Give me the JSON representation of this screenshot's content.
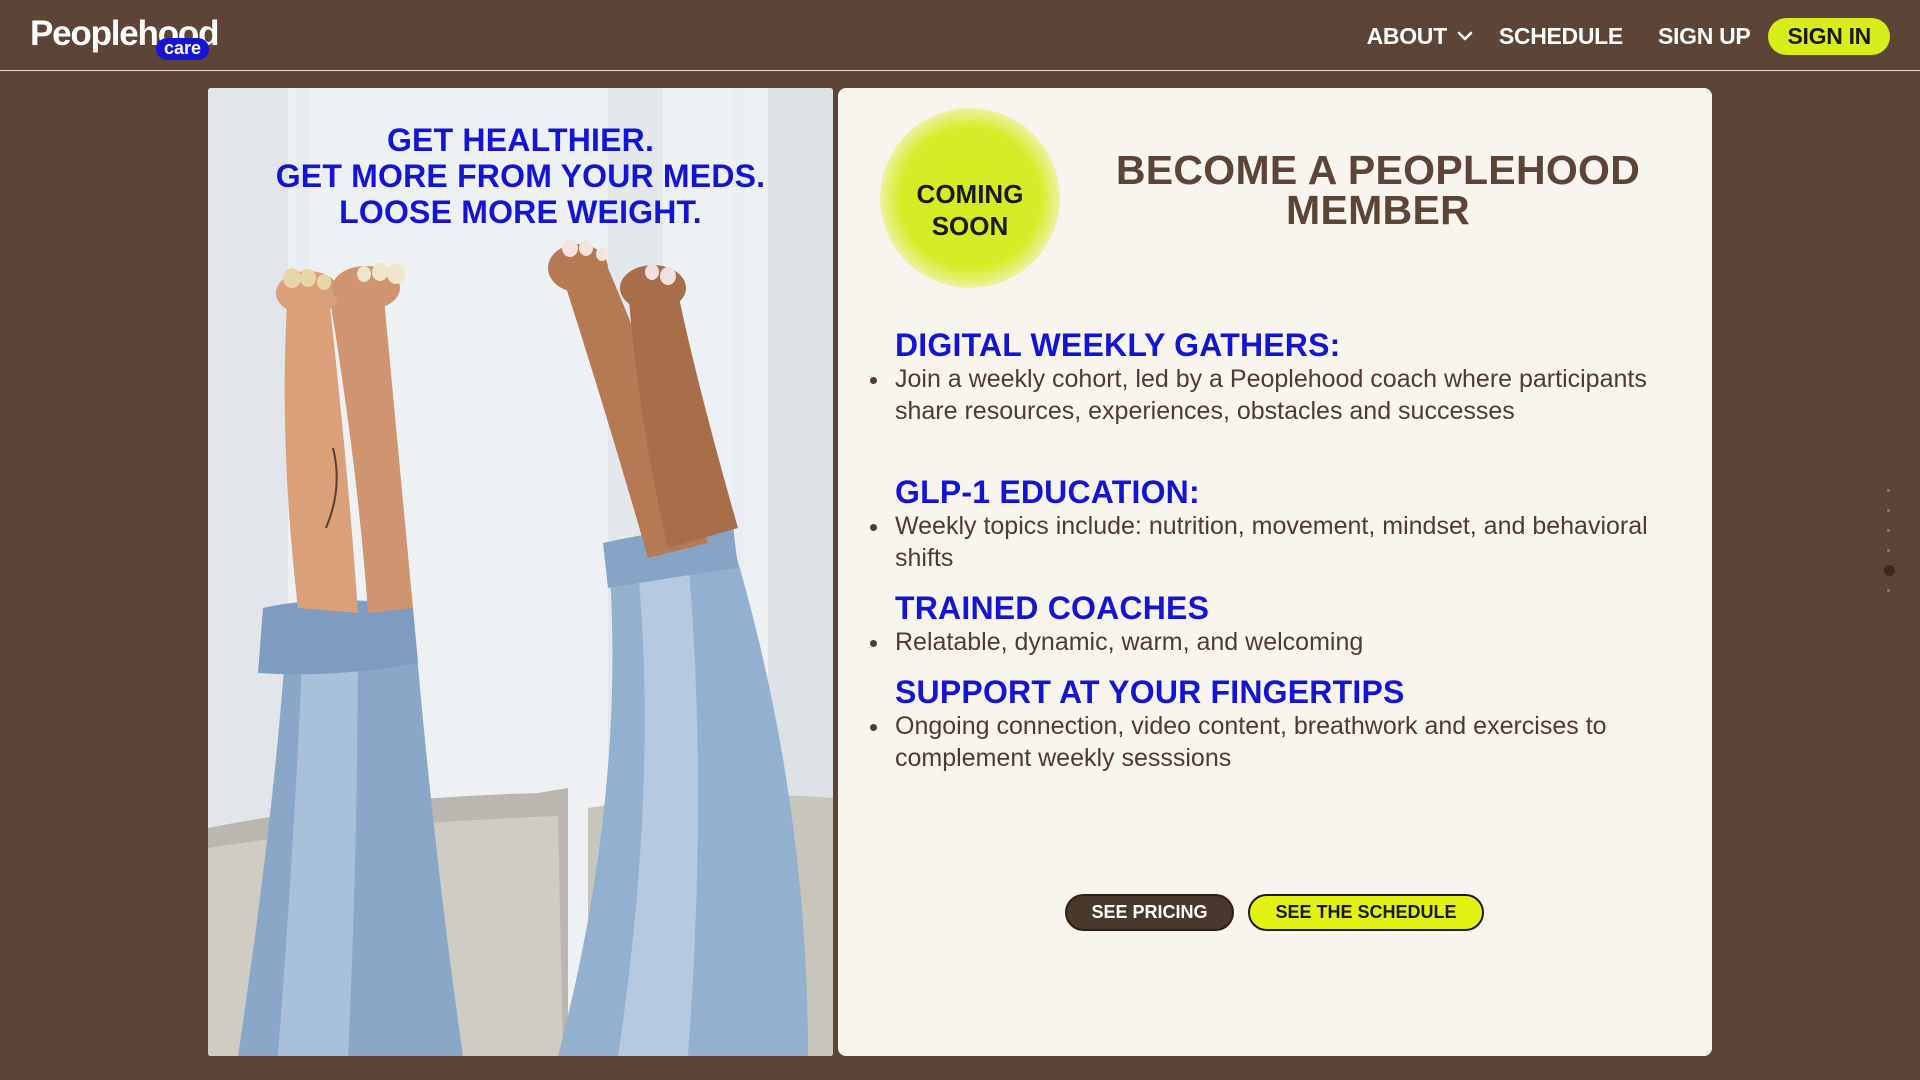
{
  "header": {
    "logo": {
      "name": "Peoplehood",
      "sub": "care"
    },
    "nav": {
      "about": "ABOUT",
      "schedule": "SCHEDULE",
      "signup": "SIGN UP",
      "signin": "SIGN IN"
    }
  },
  "hero_image": {
    "lines": [
      "GET HEALTHIER.",
      "GET MORE FROM YOUR MEDS.",
      "LOOSE MORE WEIGHT."
    ]
  },
  "card": {
    "badge": [
      "COMING",
      "SOON"
    ],
    "title": [
      "BECOME A PEOPLEHOOD",
      "MEMBER"
    ],
    "features": [
      {
        "heading": "DIGITAL WEEKLY GATHERS:",
        "text": "Join a weekly cohort, led by a Peoplehood coach where participants share resources, experiences, obstacles and successes"
      },
      {
        "heading": "GLP-1 EDUCATION:",
        "text": "Weekly topics include: nutrition, movement, mindset, and behavioral shifts"
      },
      {
        "heading": "TRAINED COACHES",
        "text": "Relatable, dynamic, warm, and welcoming"
      },
      {
        "heading": "SUPPORT AT YOUR FINGERTIPS",
        "text": "Ongoing connection, video content, breathwork and exercises to complement weekly sesssions"
      }
    ],
    "buttons": {
      "pricing": "SEE PRICING",
      "schedule": "SEE THE SCHEDULE"
    }
  },
  "colors": {
    "background": "#5c4536",
    "accent_yellow": "#d7ee1c",
    "brand_blue": "#1414d4",
    "card_bg": "#f8f4ee"
  },
  "scroll_nav": {
    "count": 6,
    "active_index": 4
  }
}
